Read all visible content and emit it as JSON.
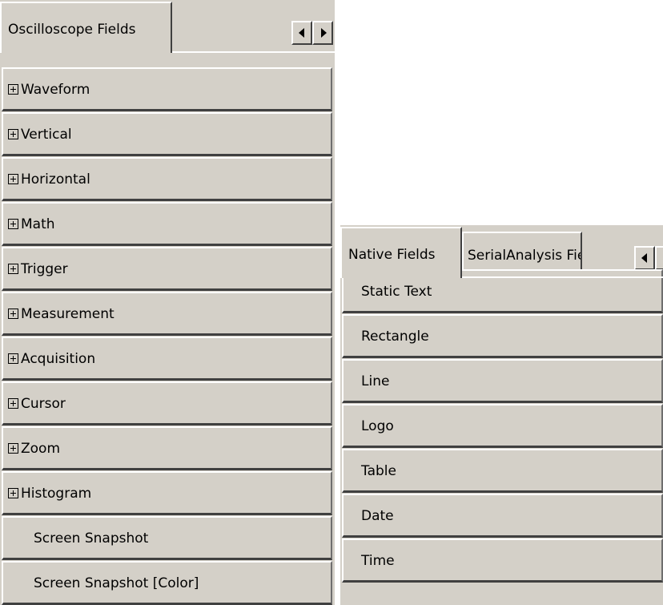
{
  "left_panel": {
    "tabs": [
      {
        "label": "Oscilloscope Fields",
        "active": true
      }
    ],
    "scroll_left_icon": "triangle-left",
    "scroll_right_icon": "triangle-right",
    "rows": [
      {
        "label": "Waveform",
        "expandable": true
      },
      {
        "label": "Vertical",
        "expandable": true
      },
      {
        "label": "Horizontal",
        "expandable": true
      },
      {
        "label": "Math",
        "expandable": true
      },
      {
        "label": "Trigger",
        "expandable": true
      },
      {
        "label": "Measurement",
        "expandable": true
      },
      {
        "label": "Acquisition",
        "expandable": true
      },
      {
        "label": "Cursor",
        "expandable": true
      },
      {
        "label": "Zoom",
        "expandable": true
      },
      {
        "label": "Histogram",
        "expandable": true
      },
      {
        "label": "Screen Snapshot",
        "expandable": false
      },
      {
        "label": "Screen Snapshot [Color]",
        "expandable": false
      }
    ]
  },
  "right_panel": {
    "tabs": [
      {
        "label": "Native Fields",
        "active": true
      },
      {
        "label": "SerialAnalysis Fields",
        "active": false
      }
    ],
    "scroll_left_icon": "triangle-left",
    "scroll_right_icon": "triangle-right",
    "rows": [
      {
        "label": "Static Text"
      },
      {
        "label": "Rectangle"
      },
      {
        "label": "Line"
      },
      {
        "label": "Logo"
      },
      {
        "label": "Table"
      },
      {
        "label": "Date"
      },
      {
        "label": "Time"
      }
    ]
  },
  "colors": {
    "face": "#d4d0c8",
    "highlight": "#ffffff",
    "shadow": "#404040",
    "background": "#ffffff"
  }
}
